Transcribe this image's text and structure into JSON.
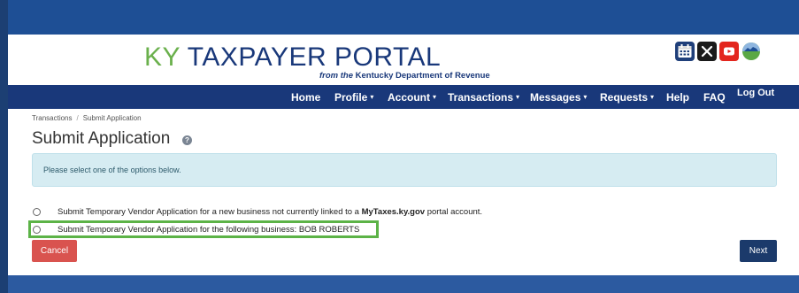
{
  "header": {
    "logo_ky": "KY",
    "logo_rest": " TAXPAYER PORTAL",
    "logo_sub_italic": "from the",
    "logo_sub_rest": " Kentucky Department of Revenue",
    "social_icons": [
      "calendar-icon",
      "x-icon",
      "youtube-icon",
      "kentucky-icon"
    ]
  },
  "nav": {
    "home": "Home",
    "profile": "Profile",
    "account": "Account",
    "transactions": "Transactions",
    "messages": "Messages",
    "requests": "Requests",
    "help": "Help",
    "faq": "FAQ",
    "logout": "Log Out",
    "caret": "▾"
  },
  "breadcrumb": {
    "parent": "Transactions",
    "separator": "/",
    "current": "Submit Application"
  },
  "page": {
    "title": "Submit Application",
    "help_icon": "question-icon",
    "alert": "Please select one of the options below."
  },
  "options": {
    "option1_prefix": "Submit Temporary Vendor Application for a new business not currently linked to a ",
    "option1_bold": "MyTaxes.ky.gov",
    "option1_suffix": " portal account.",
    "option2": "Submit Temporary Vendor Application for the following business: BOB ROBERTS"
  },
  "buttons": {
    "cancel": "Cancel",
    "next": "Next"
  },
  "colors": {
    "brand_blue": "#19387a",
    "brand_green": "#6ab04c",
    "highlight_green": "#5cb347",
    "cancel_red": "#d9534f",
    "next_blue": "#1b3a6b",
    "alert_bg": "#d6ecf2"
  }
}
